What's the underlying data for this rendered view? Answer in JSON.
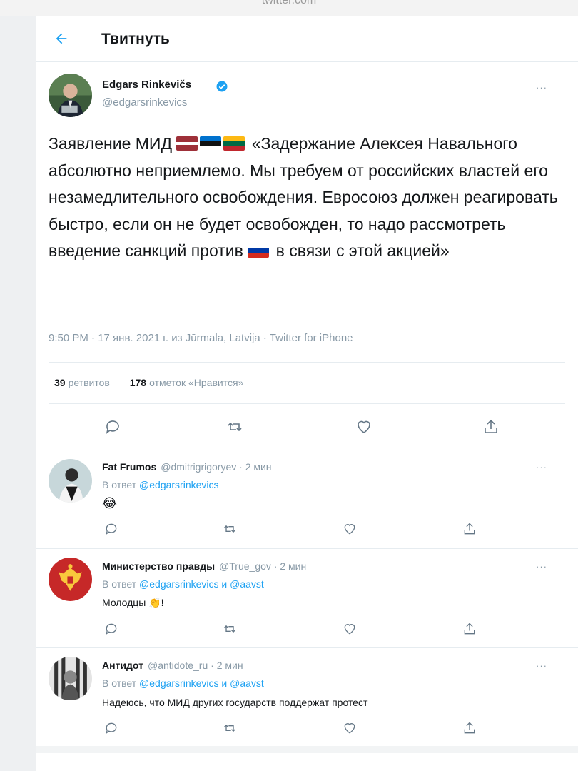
{
  "browser": {
    "url": "twitter.com"
  },
  "header": {
    "title": "Твитнуть"
  },
  "main_tweet": {
    "author_name": "Edgars Rinkēvičs",
    "author_handle": "@edgarsrinkevics",
    "text_before_flags": "Заявление МИД",
    "text_after_flags": "«Задержание Алексея Навального абсолютно неприемлемо. Мы требуем от российских властей его незамедлительного освобождения. Евросоюз должен реагировать быстро, если он не будет освобожден, то надо рассмотреть введение санкций против",
    "text_end": "в связи с этой акцией»",
    "flags": [
      "latvia-flag",
      "estonia-flag",
      "lithuania-flag"
    ],
    "inline_flag": "russia-flag",
    "meta": "9:50 PM · 17 янв. 2021 г. из Jūrmala, Latvija · Twitter for iPhone",
    "retweets_count": "39",
    "retweets_label": "ретвитов",
    "likes_count": "178",
    "likes_label": "отметок «Нравится»"
  },
  "replies": [
    {
      "name": "Fat Frumos",
      "handle_time": "@dmitrigrigoryev · 2 мин",
      "reply_prefix": "В ответ",
      "reply_to": "@edgarsrinkevics",
      "text": "😂"
    },
    {
      "name": "Министерство правды",
      "handle_time": "@True_gov · 2 мин",
      "reply_prefix": "В ответ",
      "reply_to": "@edgarsrinkevics и @aavst",
      "text": "Молодцы 👏!"
    },
    {
      "name": "Антидот",
      "handle_time": "@antidote_ru · 2 мин",
      "reply_prefix": "В ответ",
      "reply_to": "@edgarsrinkevics и @aavst",
      "text": "Надеюсь, что МИД других государств поддержат протест"
    }
  ],
  "ui": {
    "more_label": "···"
  },
  "colors": {
    "accent": "#1da1f2",
    "secondary_text": "#8899a6",
    "border": "#e6ecf0"
  }
}
